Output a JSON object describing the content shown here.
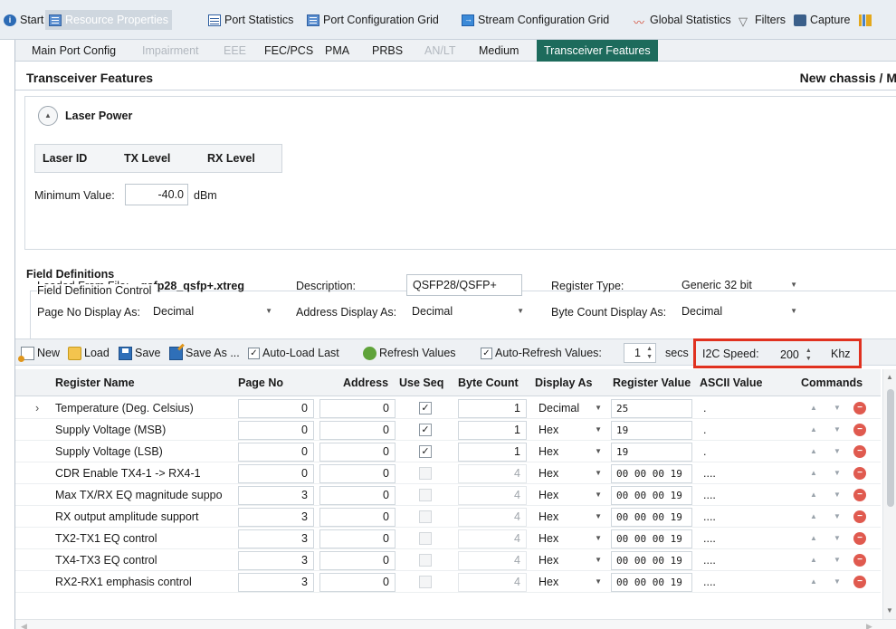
{
  "top_tabs": [
    {
      "label": "Start",
      "icon": "info-icon"
    },
    {
      "label": "Resource Properties",
      "icon": "grid-icon",
      "active": true
    },
    {
      "label": "Port Statistics",
      "icon": "sheet-icon"
    },
    {
      "label": "Port Configuration Grid",
      "icon": "grid-icon"
    },
    {
      "label": "Stream Configuration Grid",
      "icon": "stream-icon"
    },
    {
      "label": "Global Statistics",
      "icon": "chart-icon"
    },
    {
      "label": "Filters",
      "icon": "filter-icon"
    },
    {
      "label": "Capture",
      "icon": "camera-icon"
    }
  ],
  "sub_tabs": [
    {
      "label": "Main Port Config",
      "disabled": false
    },
    {
      "label": "Impairment",
      "disabled": true
    },
    {
      "label": "EEE",
      "disabled": true
    },
    {
      "label": "FEC/PCS",
      "disabled": false
    },
    {
      "label": "PMA",
      "disabled": false
    },
    {
      "label": "PRBS",
      "disabled": false
    },
    {
      "label": "AN/LT",
      "disabled": true
    },
    {
      "label": "Medium",
      "disabled": false
    },
    {
      "label": "Transceiver Features",
      "active": true
    }
  ],
  "header": {
    "title": "Transceiver Features",
    "context": "New chassis / M"
  },
  "laser_power": {
    "title": "Laser Power",
    "columns": [
      "Laser ID",
      "TX Level",
      "RX Level"
    ],
    "min_label": "Minimum Value:",
    "min_value": "-40.0",
    "min_unit": "dBm"
  },
  "field_definitions": {
    "title": "Field Definitions",
    "control_legend": "Field Definition Control",
    "loaded_label": "Loaded From File:",
    "loaded_value": "qsfp28_qsfp+.xtreg",
    "desc_label": "Description:",
    "desc_value": "QSFP28/QSFP+",
    "regtype_label": "Register Type:",
    "regtype_value": "Generic 32 bit",
    "pageno_label": "Page No Display As:",
    "pageno_value": "Decimal",
    "addr_label": "Address Display As:",
    "addr_value": "Decimal",
    "bytecount_label": "Byte Count Display As:",
    "bytecount_value": "Decimal"
  },
  "toolbar": {
    "new": "New",
    "load": "Load",
    "save": "Save",
    "save_as": "Save As ...",
    "auto_load_last": "Auto-Load Last",
    "refresh_values": "Refresh Values",
    "auto_refresh_values": "Auto-Refresh Values:",
    "refresh_interval": "1",
    "secs": "secs",
    "i2c_label": "I2C Speed:",
    "i2c_value": "200",
    "i2c_unit": "Khz"
  },
  "grid": {
    "columns": [
      "Register Name",
      "Page No",
      "Address",
      "Use Seq",
      "Byte Count",
      "Display As",
      "Register Value",
      "ASCII Value",
      "Commands"
    ],
    "rows": [
      {
        "name": "Temperature (Deg. Celsius)",
        "page": "0",
        "address": "0",
        "use_seq": true,
        "byte_count": "1",
        "display": "Decimal",
        "value": "25",
        "ascii": ".",
        "selected": true
      },
      {
        "name": "Supply Voltage (MSB)",
        "page": "0",
        "address": "0",
        "use_seq": true,
        "byte_count": "1",
        "display": "Hex",
        "value": "19",
        "ascii": "."
      },
      {
        "name": "Supply Voltage (LSB)",
        "page": "0",
        "address": "0",
        "use_seq": true,
        "byte_count": "1",
        "display": "Hex",
        "value": "19",
        "ascii": "."
      },
      {
        "name": "CDR Enable TX4-1 -> RX4-1",
        "page": "0",
        "address": "0",
        "use_seq": false,
        "byte_count": "4",
        "display": "Hex",
        "value": "00 00 00 19",
        "ascii": "...."
      },
      {
        "name": "Max TX/RX EQ magnitude suppo",
        "page": "3",
        "address": "0",
        "use_seq": false,
        "byte_count": "4",
        "display": "Hex",
        "value": "00 00 00 19",
        "ascii": "...."
      },
      {
        "name": "RX output amplitude support",
        "page": "3",
        "address": "0",
        "use_seq": false,
        "byte_count": "4",
        "display": "Hex",
        "value": "00 00 00 19",
        "ascii": "...."
      },
      {
        "name": "TX2-TX1 EQ control",
        "page": "3",
        "address": "0",
        "use_seq": false,
        "byte_count": "4",
        "display": "Hex",
        "value": "00 00 00 19",
        "ascii": "...."
      },
      {
        "name": "TX4-TX3 EQ control",
        "page": "3",
        "address": "0",
        "use_seq": false,
        "byte_count": "4",
        "display": "Hex",
        "value": "00 00 00 19",
        "ascii": "...."
      },
      {
        "name": "RX2-RX1 emphasis control",
        "page": "3",
        "address": "0",
        "use_seq": false,
        "byte_count": "4",
        "display": "Hex",
        "value": "00 00 00 19",
        "ascii": "...."
      }
    ]
  },
  "colors": {
    "accent_tab": "#1d6b5c",
    "highlight": "#e0311f"
  }
}
